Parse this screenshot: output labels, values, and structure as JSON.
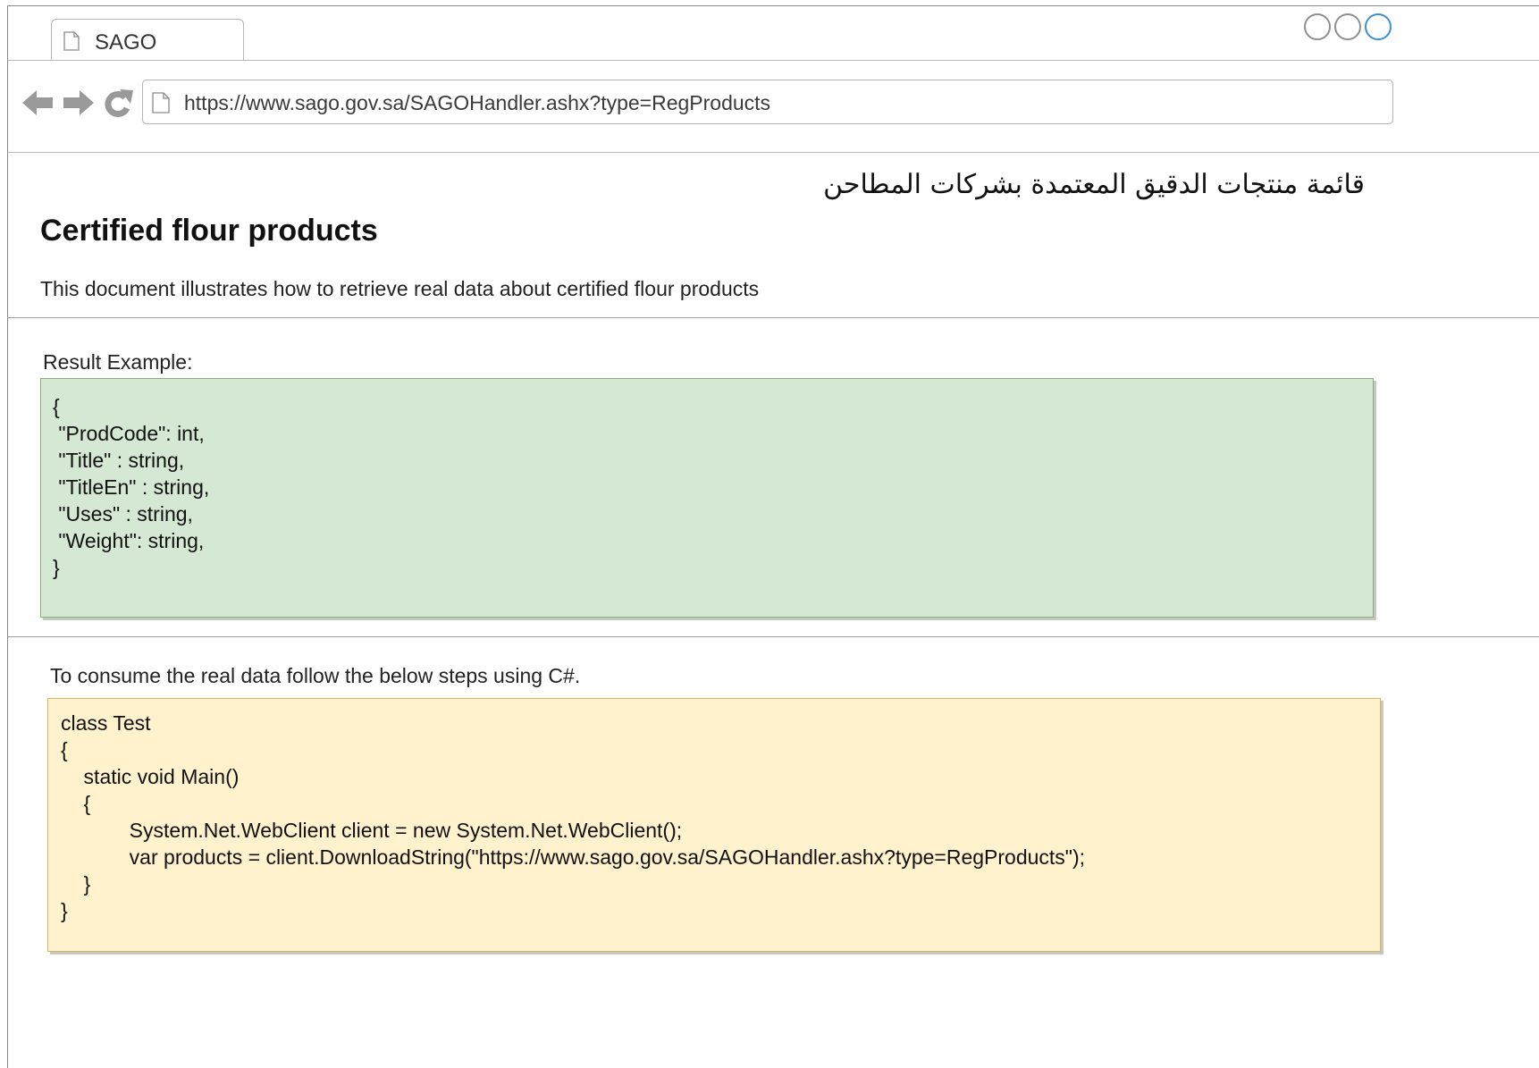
{
  "browser": {
    "tab_title": "SAGO",
    "url": "https://www.sago.gov.sa/SAGOHandler.ashx?type=RegProducts"
  },
  "page": {
    "arabic_title": "قائمة منتجات الدقيق المعتمدة بشركات المطاحن",
    "title": "Certified flour products",
    "description": "This document illustrates how to retrieve real data about certified flour products",
    "result_label": "Result Example:",
    "result_example": "{\n \"ProdCode\": int,\n \"Title\" : string,\n \"TitleEn\" : string,\n \"Uses\" : string,\n \"Weight\": string,\n}",
    "consume_label": "To consume the real data follow the below steps using C#.",
    "code_sample": "class Test\n{\n    static void Main()\n    {\n            System.Net.WebClient client = new System.Net.WebClient();\n            var products = client.DownloadString(\"https://www.sago.gov.sa/SAGOHandler.ashx?type=RegProducts\");\n    }\n}"
  },
  "colors": {
    "result_box_fill": "#d5e8d4",
    "result_box_border": "#82b366",
    "code_box_fill": "#fff2cc",
    "code_box_border": "#d6b656",
    "window_control_active": "#3b8fd6"
  },
  "icons": [
    "page-icon",
    "back-arrow-icon",
    "forward-arrow-icon",
    "reload-icon",
    "window-control-icon"
  ]
}
